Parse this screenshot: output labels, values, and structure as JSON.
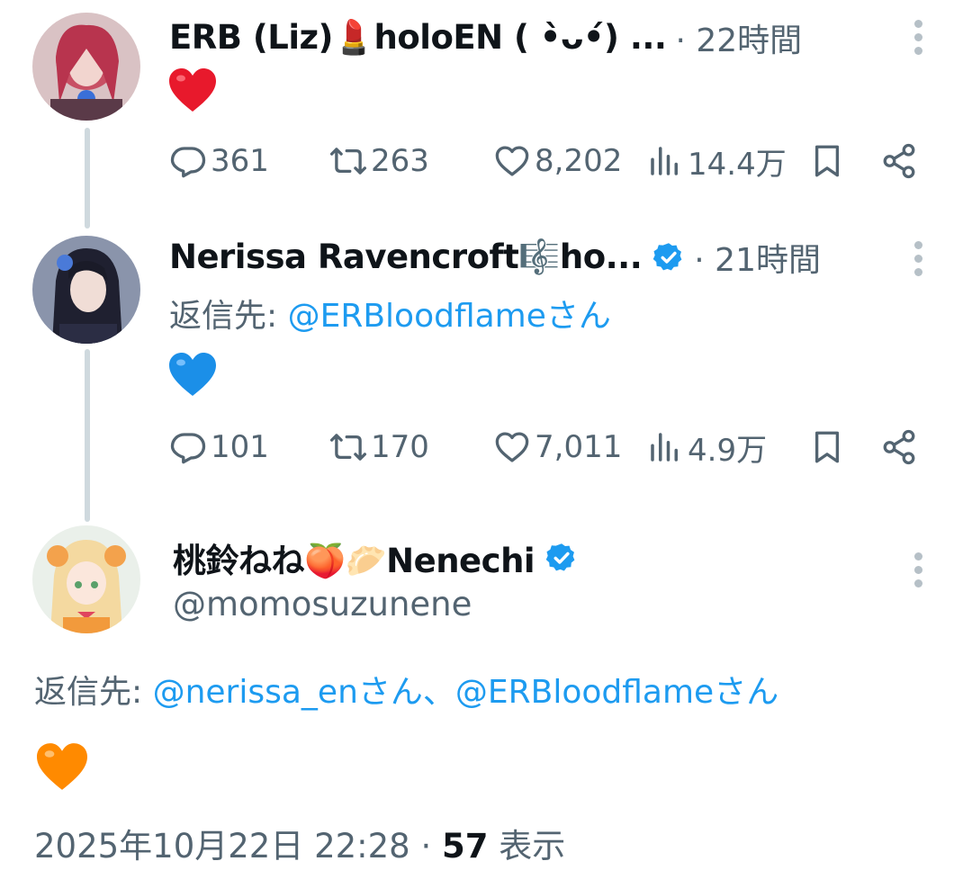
{
  "tweets": [
    {
      "display_name": "ERB (Liz)💄holoEN ( •̀ᴗ•́) ...",
      "time": "· 22時間",
      "content_emoji": "red-heart",
      "stats": {
        "replies": "361",
        "retweets": "263",
        "likes": "8,202",
        "views": "14.4万"
      }
    },
    {
      "display_name": "Nerissa Ravencroft🎼ho...",
      "time": "· 21時間",
      "reply_prefix": "返信先: ",
      "reply_mentions": "@ERBloodflameさん",
      "content_emoji": "blue-heart",
      "stats": {
        "replies": "101",
        "retweets": "170",
        "likes": "7,011",
        "views": "4.9万"
      }
    }
  ],
  "main_tweet": {
    "display_name": "桃鈴ねね🍑🥟Nenechi",
    "handle": "@momosuzunene",
    "reply_prefix": "返信先: ",
    "reply_mentions": "@nerissa_enさん、@ERBloodflameさん",
    "content_emoji": "orange-heart",
    "timestamp": "2025年10月22日 22:28 · ",
    "view_count": "57",
    "view_label": " 表示"
  },
  "colors": {
    "text": "#0f1419",
    "muted": "#536471",
    "link": "#1d9bf0",
    "thread_line": "#cfd9de",
    "verified": "#1d9bf0"
  }
}
